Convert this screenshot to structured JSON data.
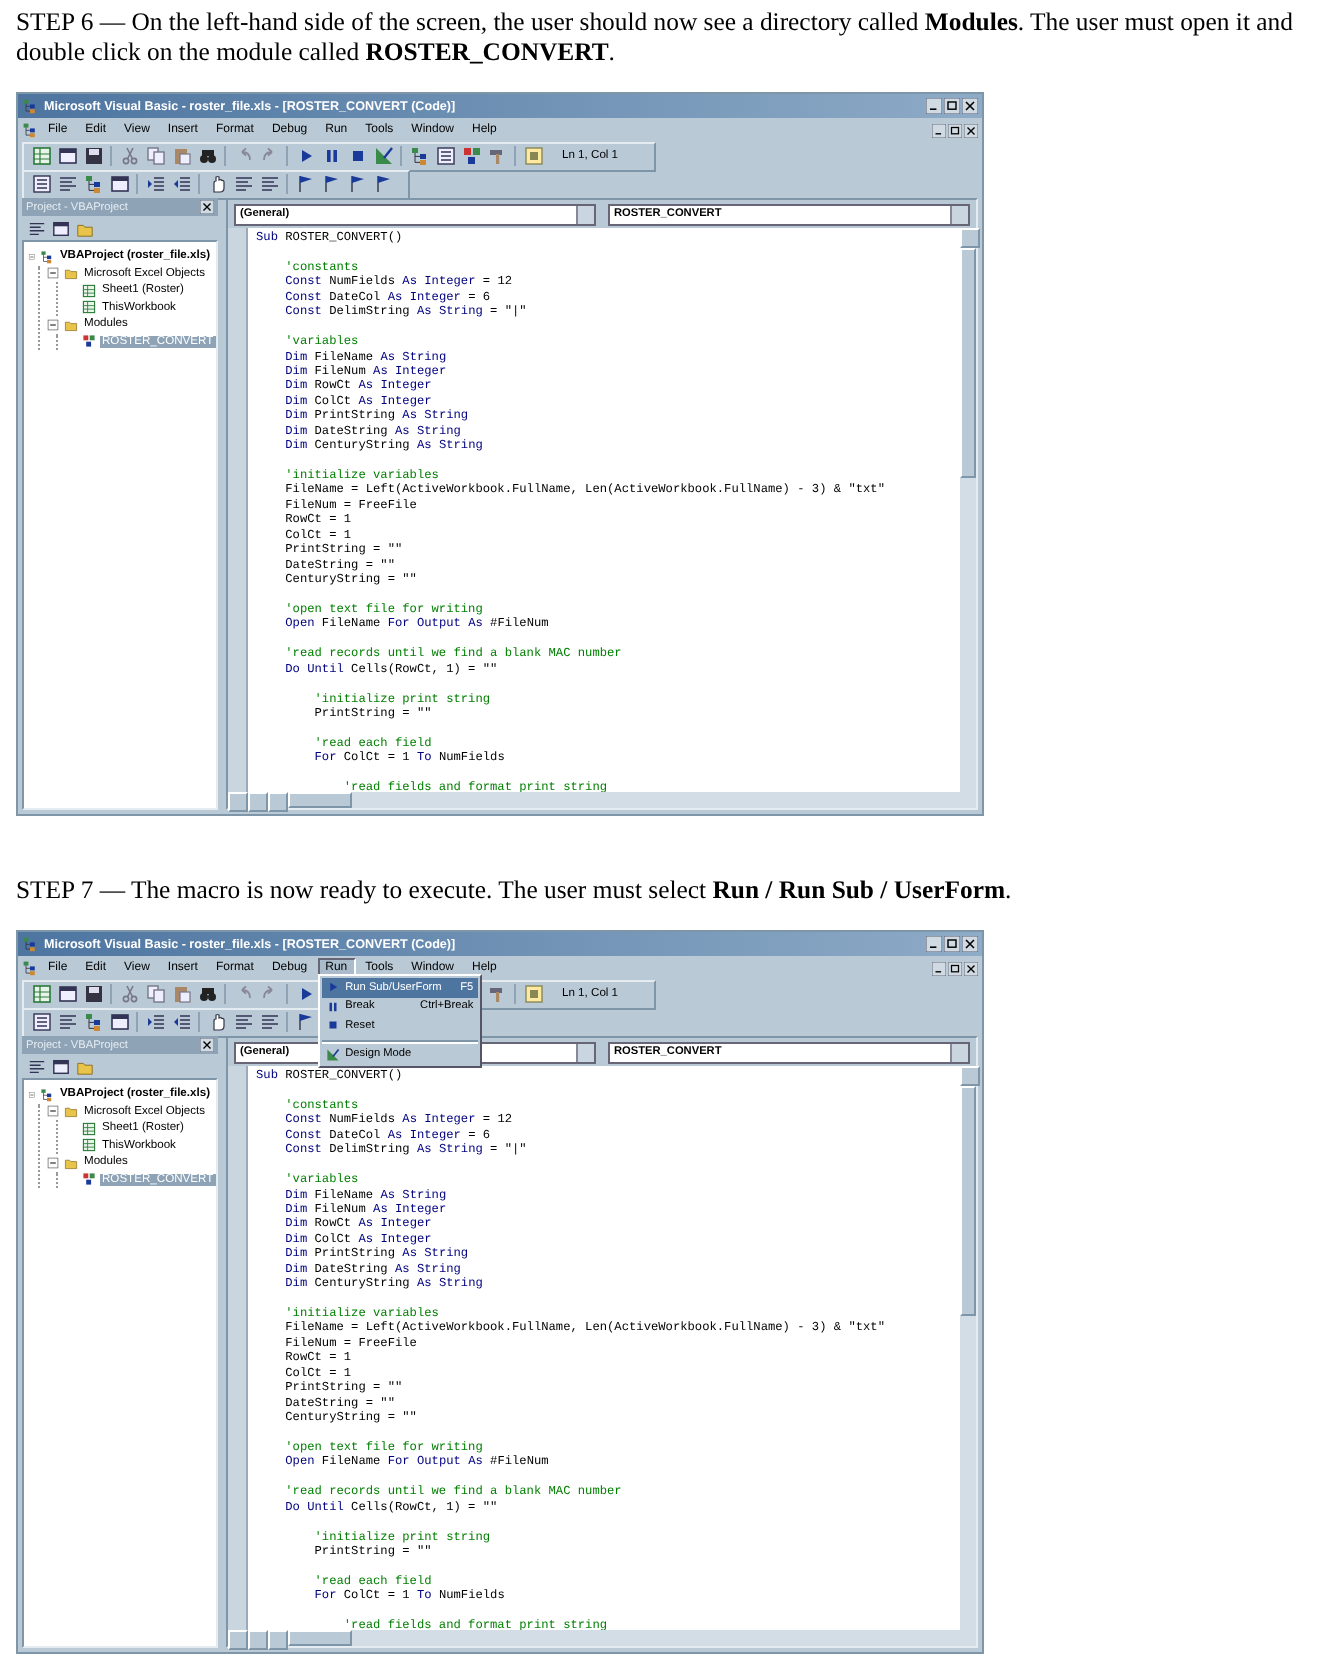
{
  "steps": [
    {
      "text": "STEP 6 — On the left-hand side of the screen, the user should now see a directory called **Modules**. The user must open it and double click on the module called **ROSTER_CONVERT**.",
      "window": {
        "title": "Microsoft Visual Basic - roster_file.xls - [ROSTER_CONVERT (Code)]",
        "menus": [
          {
            "label": "File",
            "selected": false
          },
          {
            "label": "Edit",
            "selected": false
          },
          {
            "label": "View",
            "selected": false
          },
          {
            "label": "Insert",
            "selected": false
          },
          {
            "label": "Format",
            "selected": false
          },
          {
            "label": "Debug",
            "selected": false
          },
          {
            "label": "Run",
            "selected": false
          },
          {
            "label": "Tools",
            "selected": false
          },
          {
            "label": "Window",
            "selected": false
          },
          {
            "label": "Help",
            "selected": false
          }
        ],
        "position": "Ln 1, Col 1",
        "project_panel": {
          "title": "Project - VBAProject",
          "tree": [
            {
              "label": "VBAProject (roster_file.xls)",
              "kind": "project",
              "expanded": true,
              "selected": false,
              "children": [
                {
                  "label": "Microsoft Excel Objects",
                  "kind": "folder",
                  "expanded": true,
                  "selected": false,
                  "children": [
                    {
                      "label": "Sheet1 (Roster)",
                      "kind": "sheet",
                      "selected": false
                    },
                    {
                      "label": "ThisWorkbook",
                      "kind": "sheet",
                      "selected": false
                    }
                  ]
                },
                {
                  "label": "Modules",
                  "kind": "folder",
                  "expanded": true,
                  "selected": false,
                  "children": [
                    {
                      "label": "ROSTER_CONVERT",
                      "kind": "module",
                      "selected": true
                    }
                  ]
                }
              ]
            }
          ]
        },
        "object_box": "(General)",
        "procedure_box": "ROSTER_CONVERT",
        "code": [
          {
            "kind": "code",
            "parts": [
              {
                "text": "Sub",
                "keyword": true
              },
              {
                "text": " ROSTER_CONVERT()",
                "keyword": false
              }
            ]
          },
          {
            "kind": "blank"
          },
          {
            "kind": "comment",
            "text": "    'constants"
          },
          {
            "kind": "code",
            "parts": [
              {
                "text": "    Const",
                "keyword": true
              },
              {
                "text": " NumFields ",
                "keyword": false
              },
              {
                "text": "As Integer",
                "keyword": true
              },
              {
                "text": " = 12",
                "keyword": false
              }
            ]
          },
          {
            "kind": "code",
            "parts": [
              {
                "text": "    Const",
                "keyword": true
              },
              {
                "text": " DateCol ",
                "keyword": false
              },
              {
                "text": "As Integer",
                "keyword": true
              },
              {
                "text": " = 6",
                "keyword": false
              }
            ]
          },
          {
            "kind": "code",
            "parts": [
              {
                "text": "    Const",
                "keyword": true
              },
              {
                "text": " DelimString ",
                "keyword": false
              },
              {
                "text": "As String",
                "keyword": true
              },
              {
                "text": " = \"|\"",
                "keyword": false
              }
            ]
          },
          {
            "kind": "blank"
          },
          {
            "kind": "comment",
            "text": "    'variables"
          },
          {
            "kind": "code",
            "parts": [
              {
                "text": "    Dim",
                "keyword": true
              },
              {
                "text": " FileName ",
                "keyword": false
              },
              {
                "text": "As String",
                "keyword": true
              }
            ]
          },
          {
            "kind": "code",
            "parts": [
              {
                "text": "    Dim",
                "keyword": true
              },
              {
                "text": " FileNum ",
                "keyword": false
              },
              {
                "text": "As Integer",
                "keyword": true
              }
            ]
          },
          {
            "kind": "code",
            "parts": [
              {
                "text": "    Dim",
                "keyword": true
              },
              {
                "text": " RowCt ",
                "keyword": false
              },
              {
                "text": "As Integer",
                "keyword": true
              }
            ]
          },
          {
            "kind": "code",
            "parts": [
              {
                "text": "    Dim",
                "keyword": true
              },
              {
                "text": " ColCt ",
                "keyword": false
              },
              {
                "text": "As Integer",
                "keyword": true
              }
            ]
          },
          {
            "kind": "code",
            "parts": [
              {
                "text": "    Dim",
                "keyword": true
              },
              {
                "text": " PrintString ",
                "keyword": false
              },
              {
                "text": "As String",
                "keyword": true
              }
            ]
          },
          {
            "kind": "code",
            "parts": [
              {
                "text": "    Dim",
                "keyword": true
              },
              {
                "text": " DateString ",
                "keyword": false
              },
              {
                "text": "As String",
                "keyword": true
              }
            ]
          },
          {
            "kind": "code",
            "parts": [
              {
                "text": "    Dim",
                "keyword": true
              },
              {
                "text": " CenturyString ",
                "keyword": false
              },
              {
                "text": "As String",
                "keyword": true
              }
            ]
          },
          {
            "kind": "blank"
          },
          {
            "kind": "comment",
            "text": "    'initialize variables"
          },
          {
            "kind": "code",
            "parts": [
              {
                "text": "    FileName = Left(ActiveWorkbook.FullName, Len(ActiveWorkbook.FullName) - 3) & \"txt\"",
                "keyword": false
              }
            ]
          },
          {
            "kind": "code",
            "parts": [
              {
                "text": "    FileNum = FreeFile",
                "keyword": false
              }
            ]
          },
          {
            "kind": "code",
            "parts": [
              {
                "text": "    RowCt = 1",
                "keyword": false
              }
            ]
          },
          {
            "kind": "code",
            "parts": [
              {
                "text": "    ColCt = 1",
                "keyword": false
              }
            ]
          },
          {
            "kind": "code",
            "parts": [
              {
                "text": "    PrintString = \"\"",
                "keyword": false
              }
            ]
          },
          {
            "kind": "code",
            "parts": [
              {
                "text": "    DateString = \"\"",
                "keyword": false
              }
            ]
          },
          {
            "kind": "code",
            "parts": [
              {
                "text": "    CenturyString = \"\"",
                "keyword": false
              }
            ]
          },
          {
            "kind": "blank"
          },
          {
            "kind": "comment",
            "text": "    'open text file for writing"
          },
          {
            "kind": "code",
            "parts": [
              {
                "text": "    Open",
                "keyword": true
              },
              {
                "text": " FileName ",
                "keyword": false
              },
              {
                "text": "For Output As",
                "keyword": true
              },
              {
                "text": " #FileNum",
                "keyword": false
              }
            ]
          },
          {
            "kind": "blank"
          },
          {
            "kind": "comment",
            "text": "    'read records until we find a blank MAC number"
          },
          {
            "kind": "code",
            "parts": [
              {
                "text": "    Do Until",
                "keyword": true
              },
              {
                "text": " Cells(RowCt, 1) = \"\"",
                "keyword": false
              }
            ]
          },
          {
            "kind": "blank"
          },
          {
            "kind": "comment",
            "text": "        'initialize print string"
          },
          {
            "kind": "code",
            "parts": [
              {
                "text": "        PrintString = \"\"",
                "keyword": false
              }
            ]
          },
          {
            "kind": "blank"
          },
          {
            "kind": "comment",
            "text": "        'read each field"
          },
          {
            "kind": "code",
            "parts": [
              {
                "text": "        For",
                "keyword": true
              },
              {
                "text": " ColCt = 1 ",
                "keyword": false
              },
              {
                "text": "To",
                "keyword": true
              },
              {
                "text": " NumFields",
                "keyword": false
              }
            ]
          },
          {
            "kind": "blank"
          },
          {
            "kind": "comment",
            "text": "            'read fields and format print string"
          }
        ]
      }
    },
    {
      "text": "STEP 7 — The macro is now ready to execute. The user must select **Run / Run Sub / UserForm**.",
      "window": {
        "title": "Microsoft Visual Basic - roster_file.xls - [ROSTER_CONVERT (Code)]",
        "menus": [
          {
            "label": "File",
            "selected": false
          },
          {
            "label": "Edit",
            "selected": false
          },
          {
            "label": "View",
            "selected": false
          },
          {
            "label": "Insert",
            "selected": false
          },
          {
            "label": "Format",
            "selected": false
          },
          {
            "label": "Debug",
            "selected": false
          },
          {
            "label": "Run",
            "selected": true,
            "items": [
              {
                "label": "Run Sub/UserForm",
                "shortcut": "F5",
                "kind": "run",
                "selected": true,
                "separator_before": false
              },
              {
                "label": "Break",
                "shortcut": "Ctrl+Break",
                "kind": "break",
                "selected": false,
                "separator_before": false
              },
              {
                "label": "Reset",
                "kind": "reset",
                "selected": false,
                "separator_before": false
              },
              {
                "label": "Design Mode",
                "kind": "design",
                "selected": false,
                "separator_before": true
              }
            ]
          },
          {
            "label": "Tools",
            "selected": false
          },
          {
            "label": "Window",
            "selected": false
          },
          {
            "label": "Help",
            "selected": false
          }
        ],
        "position": "Ln 1, Col 1",
        "project_panel": {
          "title": "Project - VBAProject",
          "tree": [
            {
              "label": "VBAProject (roster_file.xls)",
              "kind": "project",
              "expanded": true,
              "selected": false,
              "children": [
                {
                  "label": "Microsoft Excel Objects",
                  "kind": "folder",
                  "expanded": true,
                  "selected": false,
                  "children": [
                    {
                      "label": "Sheet1 (Roster)",
                      "kind": "sheet",
                      "selected": false
                    },
                    {
                      "label": "ThisWorkbook",
                      "kind": "sheet",
                      "selected": false
                    }
                  ]
                },
                {
                  "label": "Modules",
                  "kind": "folder",
                  "expanded": true,
                  "selected": false,
                  "children": [
                    {
                      "label": "ROSTER_CONVERT",
                      "kind": "module",
                      "selected": true
                    }
                  ]
                }
              ]
            }
          ]
        },
        "object_box": "(General)",
        "procedure_box": "ROSTER_CONVERT",
        "code": [
          {
            "kind": "code",
            "parts": [
              {
                "text": "Sub",
                "keyword": true
              },
              {
                "text": " ROSTER_CONVERT()",
                "keyword": false
              }
            ]
          },
          {
            "kind": "blank"
          },
          {
            "kind": "comment",
            "text": "    'constants"
          },
          {
            "kind": "code",
            "parts": [
              {
                "text": "    Const",
                "keyword": true
              },
              {
                "text": " NumFields ",
                "keyword": false
              },
              {
                "text": "As Integer",
                "keyword": true
              },
              {
                "text": " = 12",
                "keyword": false
              }
            ]
          },
          {
            "kind": "code",
            "parts": [
              {
                "text": "    Const",
                "keyword": true
              },
              {
                "text": " DateCol ",
                "keyword": false
              },
              {
                "text": "As Integer",
                "keyword": true
              },
              {
                "text": " = 6",
                "keyword": false
              }
            ]
          },
          {
            "kind": "code",
            "parts": [
              {
                "text": "    Const",
                "keyword": true
              },
              {
                "text": " DelimString ",
                "keyword": false
              },
              {
                "text": "As String",
                "keyword": true
              },
              {
                "text": " = \"|\"",
                "keyword": false
              }
            ]
          },
          {
            "kind": "blank"
          },
          {
            "kind": "comment",
            "text": "    'variables"
          },
          {
            "kind": "code",
            "parts": [
              {
                "text": "    Dim",
                "keyword": true
              },
              {
                "text": " FileName ",
                "keyword": false
              },
              {
                "text": "As String",
                "keyword": true
              }
            ]
          },
          {
            "kind": "code",
            "parts": [
              {
                "text": "    Dim",
                "keyword": true
              },
              {
                "text": " FileNum ",
                "keyword": false
              },
              {
                "text": "As Integer",
                "keyword": true
              }
            ]
          },
          {
            "kind": "code",
            "parts": [
              {
                "text": "    Dim",
                "keyword": true
              },
              {
                "text": " RowCt ",
                "keyword": false
              },
              {
                "text": "As Integer",
                "keyword": true
              }
            ]
          },
          {
            "kind": "code",
            "parts": [
              {
                "text": "    Dim",
                "keyword": true
              },
              {
                "text": " ColCt ",
                "keyword": false
              },
              {
                "text": "As Integer",
                "keyword": true
              }
            ]
          },
          {
            "kind": "code",
            "parts": [
              {
                "text": "    Dim",
                "keyword": true
              },
              {
                "text": " PrintString ",
                "keyword": false
              },
              {
                "text": "As String",
                "keyword": true
              }
            ]
          },
          {
            "kind": "code",
            "parts": [
              {
                "text": "    Dim",
                "keyword": true
              },
              {
                "text": " DateString ",
                "keyword": false
              },
              {
                "text": "As String",
                "keyword": true
              }
            ]
          },
          {
            "kind": "code",
            "parts": [
              {
                "text": "    Dim",
                "keyword": true
              },
              {
                "text": " CenturyString ",
                "keyword": false
              },
              {
                "text": "As String",
                "keyword": true
              }
            ]
          },
          {
            "kind": "blank"
          },
          {
            "kind": "comment",
            "text": "    'initialize variables"
          },
          {
            "kind": "code",
            "parts": [
              {
                "text": "    FileName = Left(ActiveWorkbook.FullName, Len(ActiveWorkbook.FullName) - 3) & \"txt\"",
                "keyword": false
              }
            ]
          },
          {
            "kind": "code",
            "parts": [
              {
                "text": "    FileNum = FreeFile",
                "keyword": false
              }
            ]
          },
          {
            "kind": "code",
            "parts": [
              {
                "text": "    RowCt = 1",
                "keyword": false
              }
            ]
          },
          {
            "kind": "code",
            "parts": [
              {
                "text": "    ColCt = 1",
                "keyword": false
              }
            ]
          },
          {
            "kind": "code",
            "parts": [
              {
                "text": "    PrintString = \"\"",
                "keyword": false
              }
            ]
          },
          {
            "kind": "code",
            "parts": [
              {
                "text": "    DateString = \"\"",
                "keyword": false
              }
            ]
          },
          {
            "kind": "code",
            "parts": [
              {
                "text": "    CenturyString = \"\"",
                "keyword": false
              }
            ]
          },
          {
            "kind": "blank"
          },
          {
            "kind": "comment",
            "text": "    'open text file for writing"
          },
          {
            "kind": "code",
            "parts": [
              {
                "text": "    Open",
                "keyword": true
              },
              {
                "text": " FileName ",
                "keyword": false
              },
              {
                "text": "For Output As",
                "keyword": true
              },
              {
                "text": " #FileNum",
                "keyword": false
              }
            ]
          },
          {
            "kind": "blank"
          },
          {
            "kind": "comment",
            "text": "    'read records until we find a blank MAC number"
          },
          {
            "kind": "code",
            "parts": [
              {
                "text": "    Do Until",
                "keyword": true
              },
              {
                "text": " Cells(RowCt, 1) = \"\"",
                "keyword": false
              }
            ]
          },
          {
            "kind": "blank"
          },
          {
            "kind": "comment",
            "text": "        'initialize print string"
          },
          {
            "kind": "code",
            "parts": [
              {
                "text": "        PrintString = \"\"",
                "keyword": false
              }
            ]
          },
          {
            "kind": "blank"
          },
          {
            "kind": "comment",
            "text": "        'read each field"
          },
          {
            "kind": "code",
            "parts": [
              {
                "text": "        For",
                "keyword": true
              },
              {
                "text": " ColCt = 1 ",
                "keyword": false
              },
              {
                "text": "To",
                "keyword": true
              },
              {
                "text": " NumFields",
                "keyword": false
              }
            ]
          },
          {
            "kind": "blank"
          },
          {
            "kind": "comment",
            "text": "            'read fields and format print string"
          }
        ]
      }
    }
  ]
}
